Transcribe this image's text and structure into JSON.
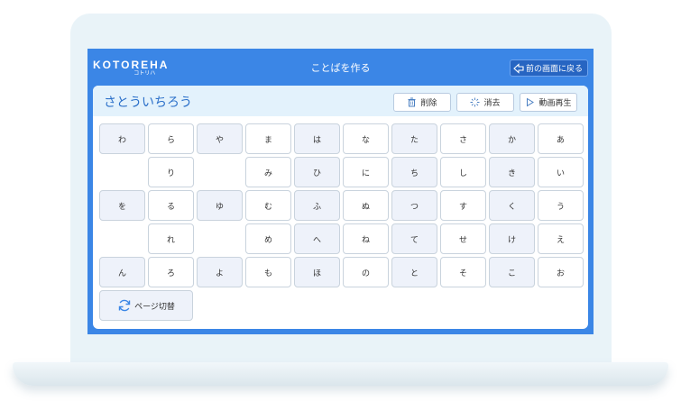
{
  "app": {
    "logo": "KOTOREHA",
    "logo_sub": "コトリハ",
    "title": "ことばを作る",
    "back_label": "前の画面に戻る"
  },
  "word": {
    "text": "さとういちろう"
  },
  "actions": {
    "delete_label": "削除",
    "clear_label": "消去",
    "play_label": "動画再生"
  },
  "page_switch_label": "ページ切替",
  "keys": [
    [
      "わ",
      "ら",
      "や",
      "ま",
      "は",
      "な",
      "た",
      "さ",
      "か",
      "あ"
    ],
    [
      "",
      "り",
      "",
      "み",
      "ひ",
      "に",
      "ち",
      "し",
      "き",
      "い"
    ],
    [
      "を",
      "る",
      "ゆ",
      "む",
      "ふ",
      "ぬ",
      "つ",
      "す",
      "く",
      "う"
    ],
    [
      "",
      "れ",
      "",
      "め",
      "へ",
      "ね",
      "て",
      "せ",
      "け",
      "え"
    ],
    [
      "ん",
      "ろ",
      "よ",
      "も",
      "ほ",
      "の",
      "と",
      "そ",
      "こ",
      "お"
    ]
  ],
  "colors": {
    "primary": "#3b86e6",
    "header_band": "#e3f2fc",
    "key_alt": "#eef2fa"
  }
}
